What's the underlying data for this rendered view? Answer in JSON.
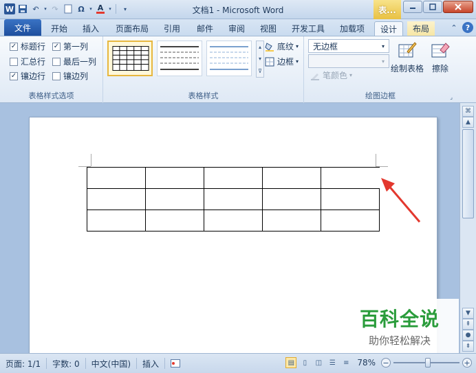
{
  "titlebar": {
    "title": "文档1 - Microsoft Word",
    "context_tab_head": "表...",
    "qat": [
      "word-icon",
      "save-icon",
      "undo-icon",
      "redo-icon",
      "new-doc-icon",
      "symbol-icon",
      "font-color-icon",
      "customize-qat-icon"
    ]
  },
  "tabs": {
    "file": "文件",
    "items": [
      "开始",
      "插入",
      "页面布局",
      "引用",
      "邮件",
      "审阅",
      "视图",
      "开发工具",
      "加载项"
    ],
    "ctx_items": [
      "设计",
      "布局"
    ],
    "active": "设计"
  },
  "ribbon": {
    "style_options": {
      "label": "表格样式选项",
      "items": [
        {
          "label": "标题行",
          "checked": true
        },
        {
          "label": "第一列",
          "checked": true
        },
        {
          "label": "汇总行",
          "checked": false
        },
        {
          "label": "最后一列",
          "checked": false
        },
        {
          "label": "镶边行",
          "checked": true
        },
        {
          "label": "镶边列",
          "checked": false
        }
      ]
    },
    "table_styles": {
      "label": "表格样式",
      "shading": "底纹",
      "borders": "边框"
    },
    "draw_borders": {
      "label": "绘图边框",
      "line_style": "无边框",
      "pen_color": "笔颜色",
      "draw_table": "绘制表格",
      "eraser": "擦除"
    }
  },
  "document": {
    "table": {
      "rows": 3,
      "cols": 5
    }
  },
  "watermark": {
    "title": "百科全说",
    "subtitle": "助你轻松解决"
  },
  "statusbar": {
    "page": "页面: 1/1",
    "words": "字数: 0",
    "language": "中文(中国)",
    "mode": "插入",
    "zoom": "78%",
    "zoom_value": 78
  },
  "colors": {
    "accent": "#2b5797",
    "ctx_tab": "#e9c143",
    "watermark_green": "#2a9c3b",
    "arrow": "#e3382e"
  }
}
